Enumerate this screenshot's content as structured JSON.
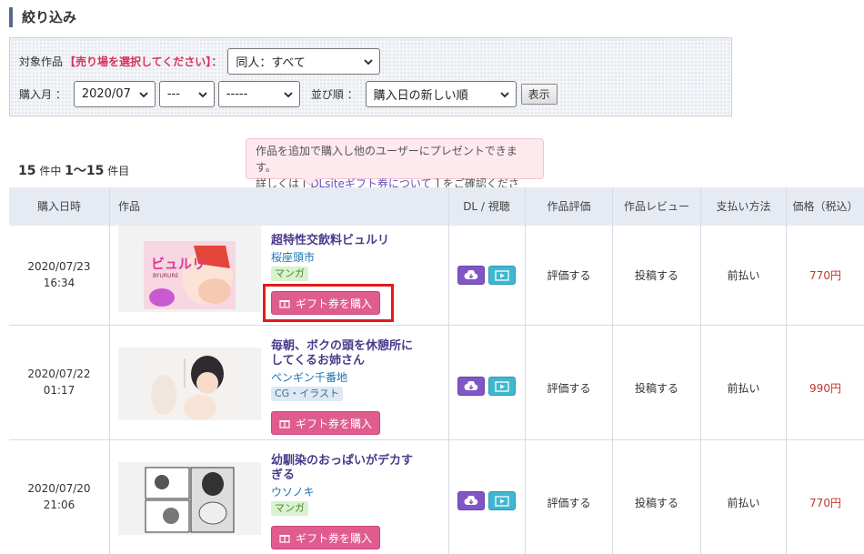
{
  "page": {
    "heading": "絞り込み"
  },
  "filter": {
    "target_label": "対象作品",
    "target_warning": "【売り場を選択してください】：",
    "target_value": "同人：すべて",
    "month_label": "購入月 ：",
    "year_month_value": "2020/07",
    "day_value": "---",
    "extra_value": "-----",
    "sort_label": "並び順 ：",
    "sort_value": "購入日の新しい順",
    "show_button": "表示"
  },
  "tooltip": {
    "line1": "作品を追加で購入し他のユーザーにプレゼントできます。",
    "line2_pre": "詳しくは [ ",
    "line2_link": "DLsiteギフト券について",
    "line2_post": " ] をご確認ください。"
  },
  "count": {
    "total": "15",
    "total_suffix": "件中",
    "range": "1〜15",
    "range_suffix": "件目"
  },
  "table": {
    "headers": {
      "date": "購入日時",
      "work": "作品",
      "dl": "DL / 視聴",
      "rating": "作品評価",
      "review": "作品レビュー",
      "payment": "支払い方法",
      "price": "価格（税込）"
    },
    "rows": [
      {
        "date": "2020/07/23",
        "time": "16:34",
        "title": "超特性交飲料ビュルリ",
        "author": "桜座頭市",
        "category": "マンガ",
        "gift_label": "ギフト券を購入",
        "rating_label": "評価する",
        "review_label": "投稿する",
        "payment": "前払い",
        "price": "770円"
      },
      {
        "date": "2020/07/22",
        "time": "01:17",
        "title_line1": "毎朝、ボクの頭を休憩所に",
        "title_line2": "してくるお姉さん",
        "author": "ペンギン千番地",
        "category": "CG・イラスト",
        "gift_label": "ギフト券を購入",
        "rating_label": "評価する",
        "review_label": "投稿する",
        "payment": "前払い",
        "price": "990円"
      },
      {
        "date": "2020/07/20",
        "time": "21:06",
        "title_line1": "幼馴染のおっぱいがデカす",
        "title_line2": "ぎる",
        "author": "ウソノキ",
        "category": "マンガ",
        "gift_label": "ギフト券を購入",
        "rating_label": "評価する",
        "review_label": "投稿する",
        "payment": "前払い",
        "price": "770円"
      }
    ]
  },
  "thumbnails": {
    "row1_text": "ビュルリ",
    "row1_subtext": "BYURURE"
  }
}
